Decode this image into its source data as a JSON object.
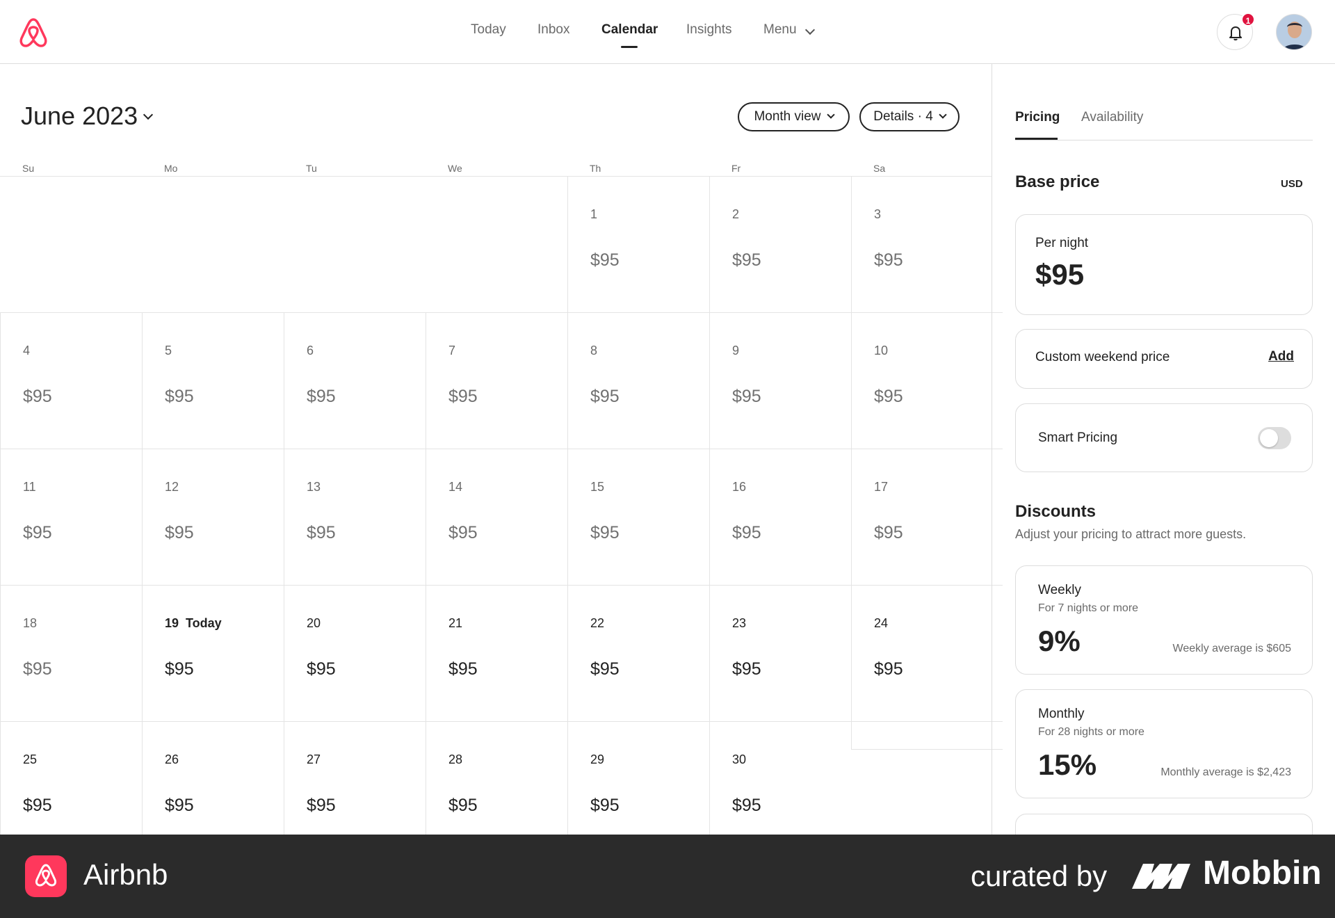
{
  "app": {
    "name": "Airbnb",
    "brand_color": "#ff385c"
  },
  "nav": {
    "items": [
      {
        "label": "Today",
        "active": false
      },
      {
        "label": "Inbox",
        "active": false
      },
      {
        "label": "Calendar",
        "active": true
      },
      {
        "label": "Insights",
        "active": false
      },
      {
        "label": "Menu",
        "active": false
      }
    ],
    "notification_count": "1"
  },
  "calendar": {
    "month_label": "June 2023",
    "view_button": "Month view",
    "details_button": "Details · 4",
    "weekdays": [
      "Su",
      "Mo",
      "Tu",
      "We",
      "Th",
      "Fr",
      "Sa"
    ],
    "today_label": "Today",
    "days": [
      {
        "day": "1",
        "price": "$95"
      },
      {
        "day": "2",
        "price": "$95"
      },
      {
        "day": "3",
        "price": "$95"
      },
      {
        "day": "4",
        "price": "$95"
      },
      {
        "day": "5",
        "price": "$95"
      },
      {
        "day": "6",
        "price": "$95"
      },
      {
        "day": "7",
        "price": "$95"
      },
      {
        "day": "8",
        "price": "$95"
      },
      {
        "day": "9",
        "price": "$95"
      },
      {
        "day": "10",
        "price": "$95"
      },
      {
        "day": "11",
        "price": "$95"
      },
      {
        "day": "12",
        "price": "$95"
      },
      {
        "day": "13",
        "price": "$95"
      },
      {
        "day": "14",
        "price": "$95"
      },
      {
        "day": "15",
        "price": "$95"
      },
      {
        "day": "16",
        "price": "$95"
      },
      {
        "day": "17",
        "price": "$95"
      },
      {
        "day": "18",
        "price": "$95"
      },
      {
        "day": "19",
        "price": "$95",
        "today": true
      },
      {
        "day": "20",
        "price": "$95"
      },
      {
        "day": "21",
        "price": "$95"
      },
      {
        "day": "22",
        "price": "$95"
      },
      {
        "day": "23",
        "price": "$95"
      },
      {
        "day": "24",
        "price": "$95"
      },
      {
        "day": "25",
        "price": "$95"
      },
      {
        "day": "26",
        "price": "$95"
      },
      {
        "day": "27",
        "price": "$95"
      },
      {
        "day": "28",
        "price": "$95"
      },
      {
        "day": "29",
        "price": "$95"
      },
      {
        "day": "30",
        "price": "$95"
      }
    ]
  },
  "panel": {
    "tabs": [
      {
        "label": "Pricing",
        "active": true
      },
      {
        "label": "Availability",
        "active": false
      }
    ],
    "base_price": {
      "title": "Base price",
      "currency": "USD",
      "per_night_label": "Per night",
      "per_night_value": "$95",
      "custom_weekend_label": "Custom weekend price",
      "custom_weekend_action": "Add",
      "smart_pricing_label": "Smart Pricing",
      "smart_pricing_on": false
    },
    "discounts": {
      "title": "Discounts",
      "subtitle": "Adjust your pricing to attract more guests.",
      "items": [
        {
          "name": "Weekly",
          "condition": "For 7 nights or more",
          "value": "9%",
          "average": "Weekly average is $605"
        },
        {
          "name": "Monthly",
          "condition": "For 28 nights or more",
          "value": "15%",
          "average": "Monthly average is $2,423"
        }
      ]
    }
  },
  "footer": {
    "app_name": "Airbnb",
    "curated_by": "curated by",
    "curator": "Mobbin"
  }
}
